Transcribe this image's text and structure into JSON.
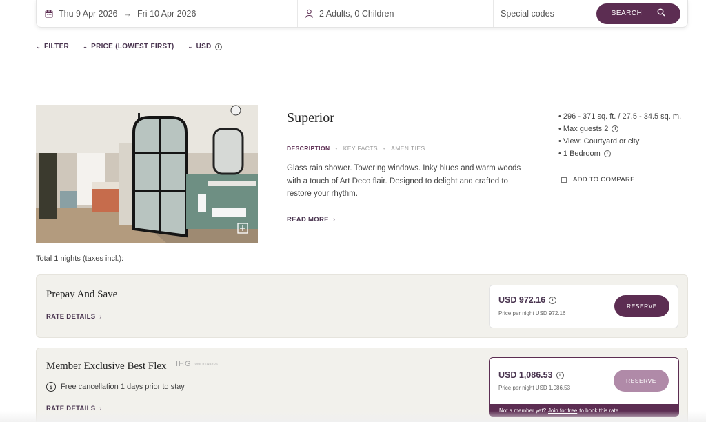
{
  "search": {
    "checkin": "Thu 9 Apr 2026",
    "checkout": "Fri 10 Apr 2026",
    "guests": "2 Adults, 0 Children",
    "special_codes_placeholder": "Special codes",
    "search_label": "SEARCH"
  },
  "filters": {
    "filter_label": "FILTER",
    "sort_label": "PRICE (LOWEST FIRST)",
    "currency_label": "USD"
  },
  "room": {
    "title": "Superior",
    "tabs": [
      "DESCRIPTION",
      "KEY FACTS",
      "AMENITIES"
    ],
    "description": "Glass rain shower. Towering windows. Inky blues and warm woods with a touch of Art Deco flair. Designed to delight and crafted to restore your rhythm.",
    "read_more": "READ MORE",
    "facts": [
      "296 - 371 sq. ft. / 27.5 - 34.5 sq. m.",
      "Max guests 2",
      "View: Courtyard or city",
      "1 Bedroom"
    ],
    "compare_label": "ADD TO COMPARE"
  },
  "total_nights": "Total 1 nights (taxes incl.):",
  "rates": [
    {
      "name": "Prepay And Save",
      "details_label": "RATE DETAILS",
      "price": "USD 972.16",
      "per_night": "Price per night USD 972.16",
      "reserve_label": "RESERVE"
    },
    {
      "name": "Member Exclusive Best Flex",
      "logo_text": "IHG",
      "logo_sub": "ONE REWARDS",
      "cancellation": "Free cancellation 1 days prior to stay",
      "details_label": "RATE DETAILS",
      "price": "USD 1,086.53",
      "per_night": "Price per night USD 1,086.53",
      "reserve_label": "RESERVE",
      "member_note_pre": "Not a member yet?",
      "member_link": "Join for free",
      "member_note_post": "to book this rate."
    }
  ],
  "colors": {
    "brand": "#5c2d52",
    "brand_light": "#b08aa8",
    "card_bg": "#f2f1ec"
  }
}
